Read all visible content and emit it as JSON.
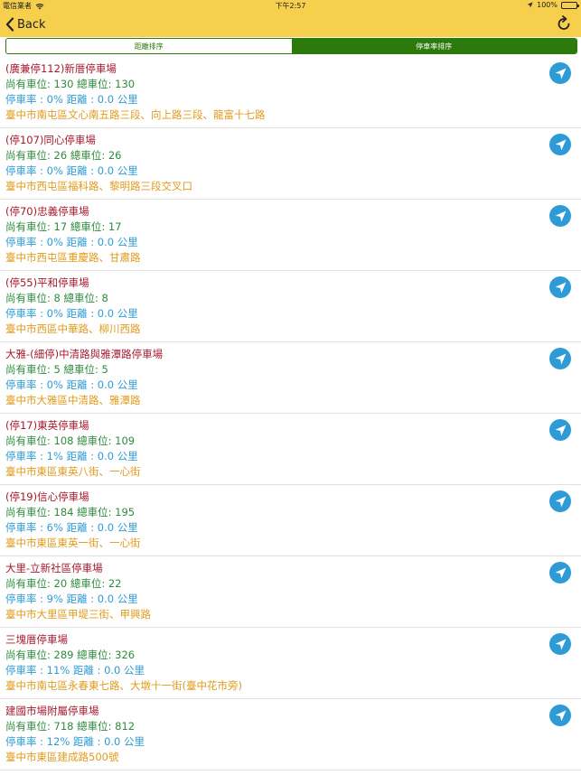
{
  "status": {
    "carrier": "電信業者",
    "time": "下午2:57",
    "battery": "100%"
  },
  "nav": {
    "back_label": "Back"
  },
  "tabs": [
    {
      "label": "距離排序",
      "active": false
    },
    {
      "label": "停車率排序",
      "active": true
    }
  ],
  "lots": [
    {
      "name": "(廣兼停112)新厝停車場",
      "spaces": "尚有車位: 130  總車位: 130",
      "rate": "停車率 : 0%  距離 : 0.0 公里",
      "address": "臺中市南屯區文心南五路三段、向上路三段、龍富十七路"
    },
    {
      "name": "(停107)同心停車場",
      "spaces": "尚有車位: 26  總車位: 26",
      "rate": "停車率 : 0%  距離 : 0.0 公里",
      "address": "臺中市西屯區福科路、黎明路三段交叉口"
    },
    {
      "name": "(停70)忠義停車場",
      "spaces": "尚有車位: 17  總車位: 17",
      "rate": "停車率 : 0%  距離 : 0.0 公里",
      "address": "臺中市西屯區重慶路、甘肅路"
    },
    {
      "name": "(停55)平和停車場",
      "spaces": "尚有車位: 8  總車位: 8",
      "rate": "停車率 : 0%  距離 : 0.0 公里",
      "address": "臺中市西區中華路、柳川西路"
    },
    {
      "name": "大雅-(細停)中清路與雅潭路停車場",
      "spaces": "尚有車位: 5  總車位: 5",
      "rate": "停車率 : 0%  距離 : 0.0 公里",
      "address": "臺中市大雅區中清路、雅潭路"
    },
    {
      "name": "(停17)東英停車場",
      "spaces": "尚有車位: 108  總車位: 109",
      "rate": "停車率 : 1%  距離 : 0.0 公里",
      "address": "臺中市東區東英八街、一心街"
    },
    {
      "name": "(停19)信心停車場",
      "spaces": "尚有車位: 184  總車位: 195",
      "rate": "停車率 : 6%  距離 : 0.0 公里",
      "address": "臺中市東區東英一街、一心街"
    },
    {
      "name": "大里-立新社區停車場",
      "spaces": "尚有車位: 20  總車位: 22",
      "rate": "停車率 : 9%  距離 : 0.0 公里",
      "address": "臺中市大里區甲堤三街、甲興路"
    },
    {
      "name": "三塊厝停車場",
      "spaces": "尚有車位: 289  總車位: 326",
      "rate": "停車率 : 11%  距離 : 0.0 公里",
      "address": "臺中市南屯區永春東七路、大墩十一街(臺中花市旁)"
    },
    {
      "name": "建國市場附屬停車場",
      "spaces": "尚有車位: 718  總車位: 812",
      "rate": "停車率 : 12%  距離 : 0.0 公里",
      "address": "臺中市東區建成路500號"
    }
  ]
}
